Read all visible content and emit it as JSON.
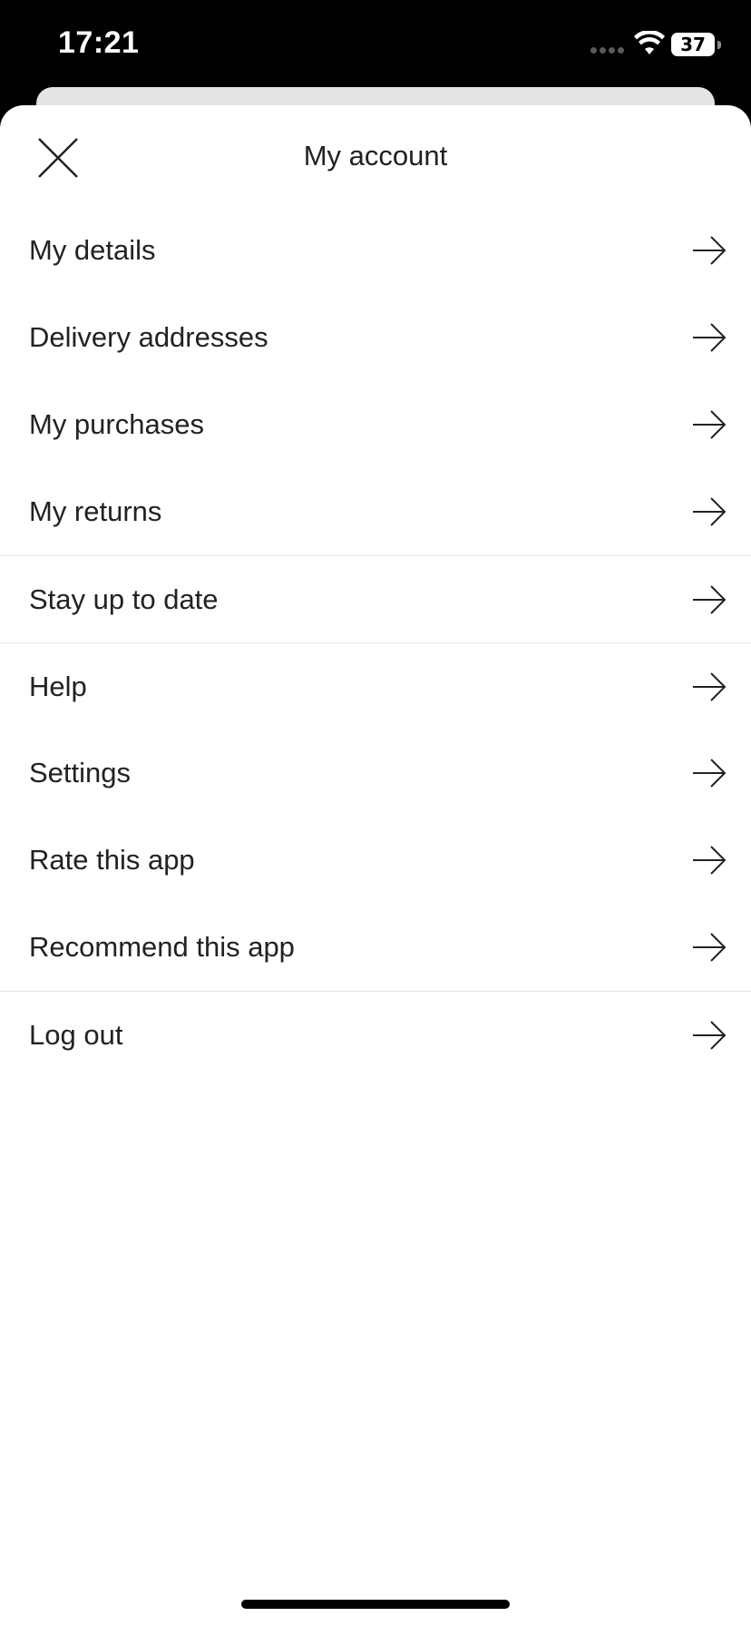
{
  "status_bar": {
    "time": "17:21",
    "battery_level": "37"
  },
  "sheet": {
    "title": "My account",
    "close_icon": "close-icon"
  },
  "menu": {
    "items": [
      {
        "label": "My details",
        "icon": "arrow-right-icon"
      },
      {
        "label": "Delivery addresses",
        "icon": "arrow-right-icon"
      },
      {
        "label": "My purchases",
        "icon": "arrow-right-icon"
      },
      {
        "label": "My returns",
        "icon": "arrow-right-icon"
      },
      {
        "label": "Stay up to date",
        "icon": "arrow-right-icon"
      },
      {
        "label": "Help",
        "icon": "arrow-right-icon"
      },
      {
        "label": "Settings",
        "icon": "arrow-right-icon"
      },
      {
        "label": "Rate this app",
        "icon": "arrow-right-icon"
      },
      {
        "label": "Recommend this app",
        "icon": "arrow-right-icon"
      },
      {
        "label": "Log out",
        "icon": "arrow-right-icon"
      }
    ]
  },
  "colors": {
    "text": "#222222",
    "divider": "#e6e6e6",
    "background": "#ffffff",
    "status_bar": "#000000"
  }
}
